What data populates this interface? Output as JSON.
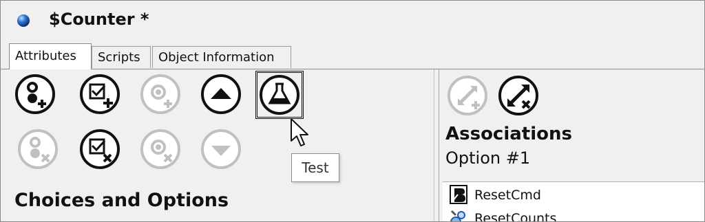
{
  "window": {
    "title": "$Counter *",
    "title_icon": "blue-sphere-icon"
  },
  "tabs": [
    {
      "label": "Attributes",
      "active": true
    },
    {
      "label": "Scripts",
      "active": false
    },
    {
      "label": "Object Information",
      "active": false
    }
  ],
  "toolbar": {
    "buttons": [
      {
        "name": "add-choice-icon",
        "enabled": true
      },
      {
        "name": "add-option-icon",
        "enabled": true
      },
      {
        "name": "add-sub-choice-icon",
        "enabled": false
      },
      {
        "name": "move-up-icon",
        "enabled": true
      },
      {
        "name": "test-flask-icon",
        "enabled": true,
        "selected": true
      },
      {
        "name": "delete-choice-icon",
        "enabled": false
      },
      {
        "name": "delete-option-icon",
        "enabled": true
      },
      {
        "name": "delete-sub-choice-icon",
        "enabled": false
      },
      {
        "name": "move-down-icon",
        "enabled": false
      }
    ],
    "tooltip": "Test"
  },
  "left": {
    "heading": "Choices and Options"
  },
  "right": {
    "buttons": [
      {
        "name": "add-association-icon",
        "enabled": false
      },
      {
        "name": "delete-association-icon",
        "enabled": true
      }
    ],
    "heading": "Associations",
    "subheading": "Option #1",
    "items": [
      {
        "label": "ResetCmd",
        "icon": "script-command-icon"
      },
      {
        "label": "ResetCounts",
        "icon": "script-gear-icon"
      }
    ]
  },
  "colors": {
    "background": "#f0f0f0",
    "enabled_icon": "#111111",
    "disabled_icon": "#c0c0c0",
    "title_icon": "#1a5fb4"
  }
}
